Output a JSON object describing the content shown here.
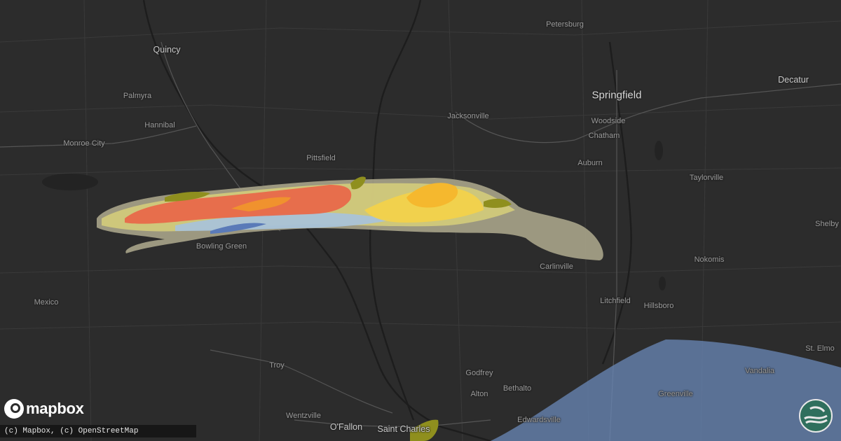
{
  "map": {
    "basemap": "dark",
    "places": [
      {
        "name": "Petersburg",
        "tier": "minor"
      },
      {
        "name": "Quincy",
        "tier": "mid"
      },
      {
        "name": "Decatur",
        "tier": "mid"
      },
      {
        "name": "Springfield",
        "tier": "major"
      },
      {
        "name": "Palmyra",
        "tier": "minor"
      },
      {
        "name": "Hannibal",
        "tier": "minor"
      },
      {
        "name": "Jacksonville",
        "tier": "minor"
      },
      {
        "name": "Woodside",
        "tier": "minor"
      },
      {
        "name": "Chatham",
        "tier": "minor"
      },
      {
        "name": "Monroe City",
        "tier": "minor"
      },
      {
        "name": "Pittsfield",
        "tier": "minor"
      },
      {
        "name": "Auburn",
        "tier": "minor"
      },
      {
        "name": "Taylorville",
        "tier": "minor"
      },
      {
        "name": "Shelby",
        "tier": "minor"
      },
      {
        "name": "Bowling Green",
        "tier": "minor"
      },
      {
        "name": "Carlinville",
        "tier": "minor"
      },
      {
        "name": "Nokomis",
        "tier": "minor"
      },
      {
        "name": "Mexico",
        "tier": "minor"
      },
      {
        "name": "Litchfield",
        "tier": "minor"
      },
      {
        "name": "Hillsboro",
        "tier": "minor"
      },
      {
        "name": "St. Elmo",
        "tier": "minor"
      },
      {
        "name": "Troy",
        "tier": "minor"
      },
      {
        "name": "Godfrey",
        "tier": "minor"
      },
      {
        "name": "Vandalia",
        "tier": "minor"
      },
      {
        "name": "Bethalto",
        "tier": "minor"
      },
      {
        "name": "Greenville",
        "tier": "minor"
      },
      {
        "name": "Alton",
        "tier": "minor"
      },
      {
        "name": "Wentzville",
        "tier": "minor"
      },
      {
        "name": "O'Fallon",
        "tier": "mid"
      },
      {
        "name": "Saint Charles",
        "tier": "mid"
      },
      {
        "name": "Edwardsville",
        "tier": "minor"
      }
    ],
    "overlay_colors": {
      "outer": "#a9a48a",
      "light_yellow": "#d7cf7a",
      "yellow": "#f2d24b",
      "gold": "#f5b82e",
      "orange_red": "#e8694a",
      "orange": "#f0922e",
      "light_blue": "#a9c3d8",
      "blue": "#5a7ab8",
      "olive": "#8f8f1e",
      "advisory_blue": "#6a88b8"
    }
  },
  "branding": {
    "logo_text": "mapbox",
    "attribution": "(c) Mapbox, (c) OpenStreetMap",
    "badge_icon": "wave-globe-icon"
  }
}
